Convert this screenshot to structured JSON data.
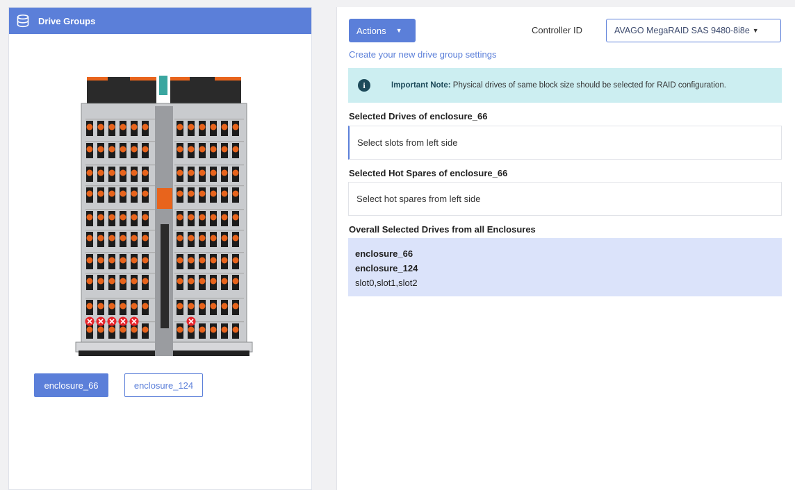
{
  "left": {
    "title": "Drive Groups",
    "title_icon": "database-icon",
    "enclosure_buttons": [
      {
        "label": "enclosure_66",
        "active": true
      },
      {
        "label": "enclosure_124",
        "active": false
      }
    ]
  },
  "right": {
    "actions_label": "Actions",
    "controller_label": "Controller ID",
    "controller_value": "AVAGO MegaRAID SAS 9480-8i8e",
    "create_link": "Create your new drive group settings",
    "note": {
      "bold": "Important Note:",
      "text": " Physical drives of same block size should be selected for RAID configuration."
    },
    "selected_drives_title": "Selected Drives of enclosure_66",
    "selected_drives_placeholder": "Select slots from left side",
    "hot_spares_title": "Selected Hot Spares of enclosure_66",
    "hot_spares_placeholder": "Select hot spares from left side",
    "overall_title": "Overall Selected Drives from all Enclosures",
    "overall": {
      "enclosure_a": "enclosure_66",
      "enclosure_b": "enclosure_124",
      "slots": "slot0,slot1,slot2"
    }
  },
  "colors": {
    "primary": "#5b7fd9",
    "note_bg": "#cceef1",
    "overall_bg": "#dbe3fa",
    "drive_orange": "#e8641c",
    "selected_red": "#e8242a"
  }
}
